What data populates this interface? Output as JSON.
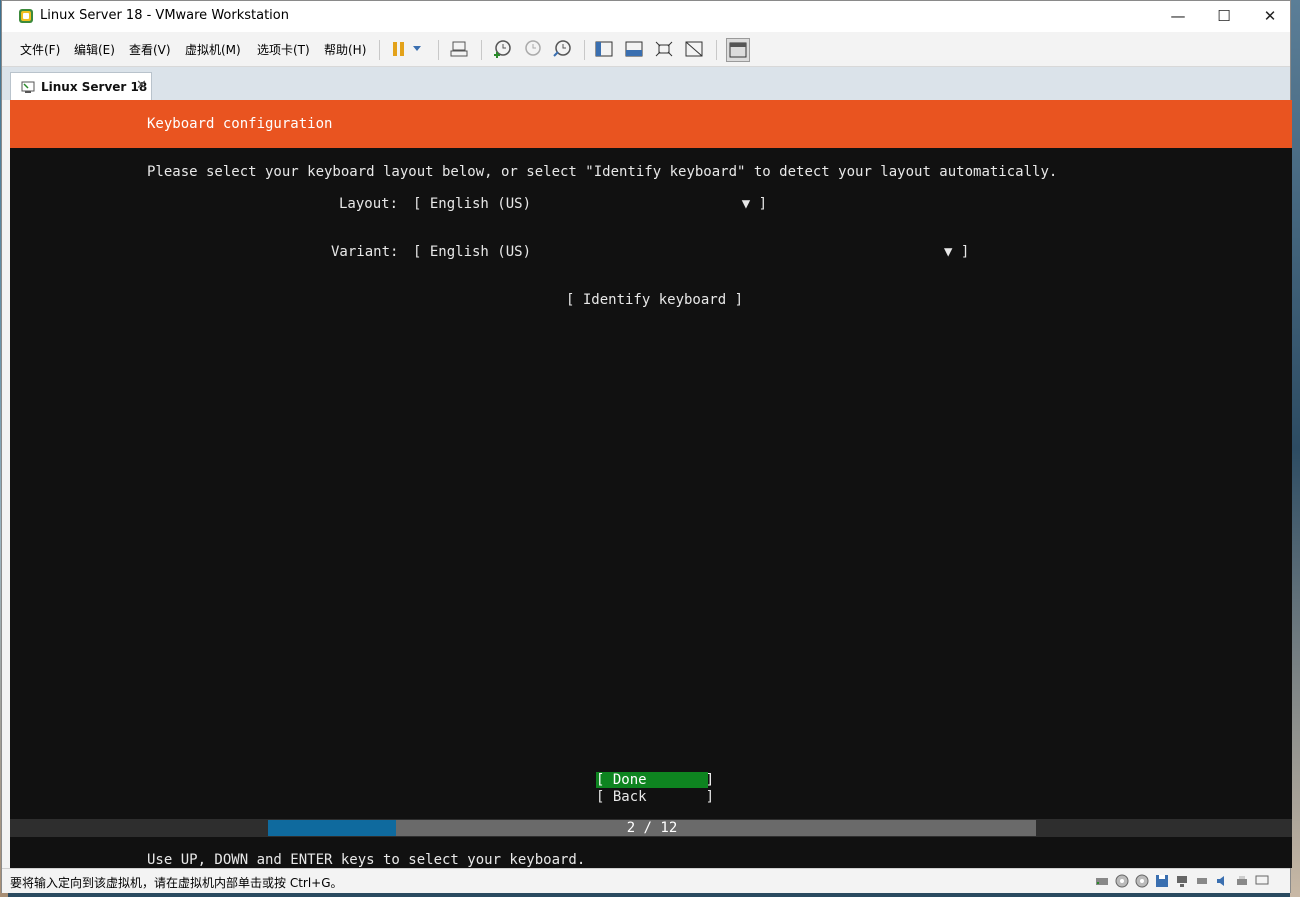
{
  "window": {
    "title": "Linux Server 18 - VMware Workstation"
  },
  "window_controls": {
    "minimize": "—",
    "maximize": "☐",
    "close": "✕"
  },
  "menu": {
    "items": [
      "文件(F)",
      "编辑(E)",
      "查看(V)",
      "虚拟机(M)",
      "选项卡(T)",
      "帮助(H)"
    ]
  },
  "toolbar": {
    "icons": [
      "pause-icon",
      "dropdown-icon",
      "send-ctrl-alt-del-icon",
      "snapshot-icon",
      "revert-snapshot-icon",
      "snapshot-manager-icon",
      "library-view-icon",
      "console-view-icon",
      "fullscreen-icon",
      "unity-icon",
      "thumbnail-view-icon"
    ]
  },
  "tab": {
    "label": "Linux Server 18",
    "close": "✕"
  },
  "installer": {
    "header": "Keyboard configuration",
    "intro": "Please select your keyboard layout below, or select \"Identify keyboard\" to detect your layout automatically.",
    "layout_label": "Layout:",
    "layout_value": "[ English (US)                         ▼ ]",
    "variant_label": "Variant:",
    "variant_value": "[ English (US)                                                 ▼ ]",
    "identify_button": "[ Identify keyboard ]",
    "done_button": "[ Done       ]",
    "back_button": "[ Back       ]",
    "progress_text": "2 / 12",
    "progress_fraction": 0.1667,
    "footer": "Use UP, DOWN and ENTER keys to select your keyboard."
  },
  "status": {
    "text": "要将输入定向到该虚拟机，请在虚拟机内部单击或按 Ctrl+G。",
    "icons": [
      "hard-disk-icon",
      "cd-rom-icon",
      "cd-rom-2-icon",
      "floppy-icon",
      "network-icon",
      "usb-icon",
      "sound-icon",
      "printer-icon",
      "display-icon"
    ]
  },
  "colors": {
    "installer_header": "#e95420",
    "done_highlight": "#0e8420",
    "progress_fill": "#0f6a9e",
    "pause_icon": "#e3a21a"
  }
}
